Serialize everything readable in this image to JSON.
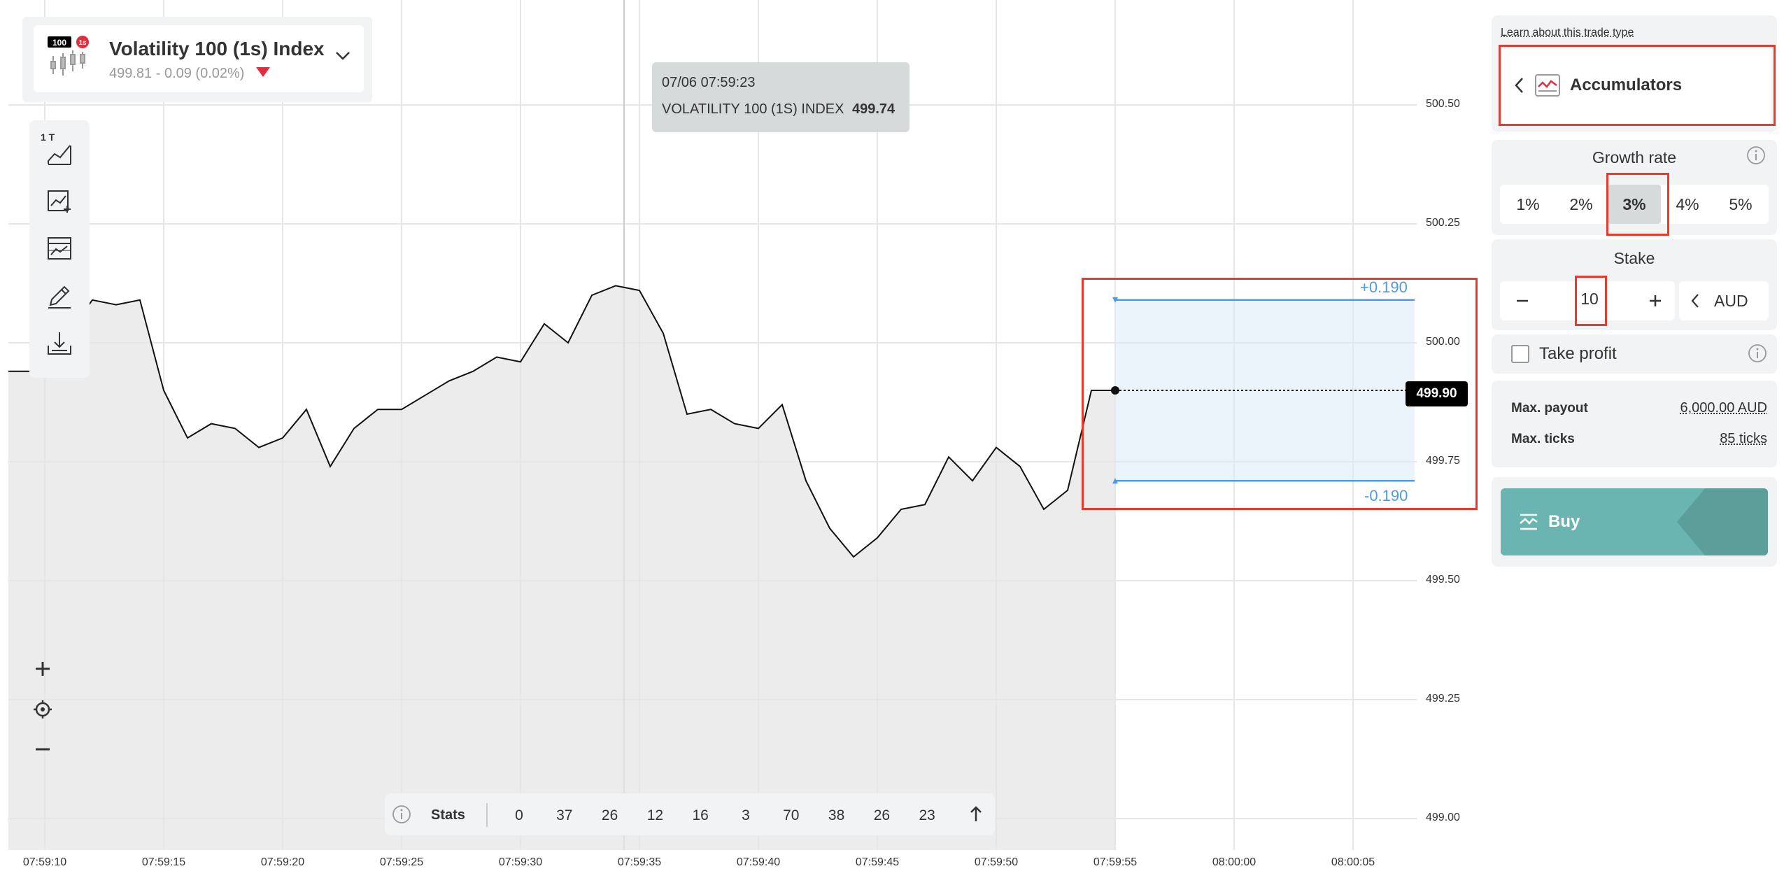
{
  "symbol": {
    "badge_number": "100",
    "badge_interval": "1s",
    "name": "Volatility 100 (1s) Index",
    "price_change": "499.81 - 0.09 (0.02%)"
  },
  "toolbar": {
    "chart_type_label": "1 T"
  },
  "tooltip": {
    "datetime": "07/06 07:59:23",
    "symbol": "VOLATILITY 100 (1S) INDEX",
    "value": "499.74"
  },
  "chart_data": {
    "type": "area",
    "title": "",
    "xlabel": "",
    "ylabel": "",
    "ylim": [
      498.93,
      500.6
    ],
    "y_ticks": [
      "500.50",
      "500.25",
      "500.00",
      "499.75",
      "499.50",
      "499.25",
      "499.00"
    ],
    "x_ticks": [
      "07:59:10",
      "07:59:15",
      "07:59:20",
      "07:59:25",
      "07:59:30",
      "07:59:35",
      "07:59:40",
      "07:59:45",
      "07:59:50",
      "07:59:55",
      "08:00:00",
      "08:00:05"
    ],
    "series": [
      {
        "x": [
          "07:59:10",
          "07:59:11",
          "07:59:12",
          "07:59:13",
          "07:59:14",
          "07:59:15",
          "07:59:16",
          "07:59:17",
          "07:59:18",
          "07:59:19",
          "07:59:20",
          "07:59:21",
          "07:59:22",
          "07:59:23",
          "07:59:24",
          "07:59:25",
          "07:59:26",
          "07:59:27",
          "07:59:28",
          "07:59:29",
          "07:59:30",
          "07:59:31",
          "07:59:32",
          "07:59:33",
          "07:59:34",
          "07:59:35",
          "07:59:36",
          "07:59:37",
          "07:59:38",
          "07:59:39",
          "07:59:40",
          "07:59:41",
          "07:59:42",
          "07:59:43",
          "07:59:44",
          "07:59:45",
          "07:59:46",
          "07:59:47",
          "07:59:48",
          "07:59:49",
          "07:59:50",
          "07:59:51",
          "07:59:52",
          "07:59:53",
          "07:59:54",
          "07:59:55"
        ],
        "y": [
          499.94,
          500.02,
          500.09,
          500.08,
          500.09,
          499.9,
          499.8,
          499.83,
          499.82,
          499.78,
          499.8,
          499.86,
          499.74,
          499.82,
          499.86,
          499.86,
          499.89,
          499.92,
          499.94,
          499.97,
          499.96,
          500.04,
          500.0,
          500.1,
          500.12,
          500.11,
          500.02,
          499.85,
          499.86,
          499.83,
          499.82,
          499.87,
          499.71,
          499.61,
          499.55,
          499.59,
          499.65,
          499.66,
          499.76,
          499.71,
          499.78,
          499.74,
          499.65,
          499.69,
          499.9,
          499.9
        ]
      }
    ],
    "current_price": "499.90",
    "upper_barrier_label": "+0.190",
    "lower_barrier_label": "-0.190",
    "upper_barrier": 500.09,
    "lower_barrier": 499.71,
    "barrier_start_x": "07:59:55",
    "crosshair_x": "07:59:35"
  },
  "stats": {
    "label": "Stats",
    "values": [
      "0",
      "37",
      "26",
      "12",
      "16",
      "3",
      "70",
      "38",
      "26",
      "23"
    ]
  },
  "panel": {
    "learn_link": "Learn about this trade type",
    "trade_type": "Accumulators",
    "growth_title": "Growth rate",
    "growth_options": [
      "1%",
      "2%",
      "3%",
      "4%",
      "5%"
    ],
    "growth_selected": "3%",
    "stake_title": "Stake",
    "stake_value": "10",
    "currency": "AUD",
    "take_profit_label": "Take profit",
    "max_payout_label": "Max. payout",
    "max_payout_value": "6,000.00 AUD",
    "max_ticks_label": "Max. ticks",
    "max_ticks_value": "85 ticks",
    "buy_label": "Buy"
  },
  "colors": {
    "accent_red": "#e12e3e",
    "barrier_blue": "#4f9ae6",
    "buy_teal": "#6ab5b1",
    "highlight_red": "#e63b2e"
  }
}
